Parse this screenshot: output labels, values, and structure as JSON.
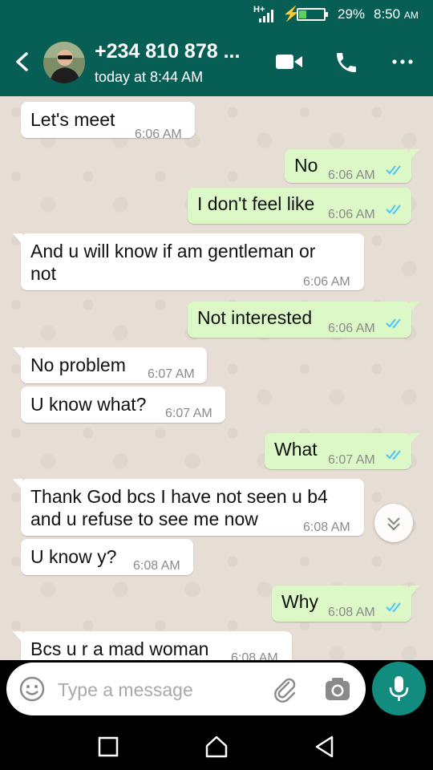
{
  "status_bar": {
    "network": "H+",
    "battery_level": 0.29,
    "battery_percent": "29%",
    "time": "8:50",
    "ampm": "AM"
  },
  "header": {
    "contact": "+234 810 878 ...",
    "last_seen": "today at 8:44 AM"
  },
  "messages": [
    {
      "dir": "in",
      "text": "Let's meet",
      "time": "6:06 AM"
    },
    {
      "dir": "out",
      "text": "No",
      "time": "6:06 AM",
      "read": true
    },
    {
      "dir": "out",
      "text": "I don't feel like",
      "time": "6:06 AM",
      "read": true
    },
    {
      "dir": "in",
      "line1": "And u will know if am gentleman or",
      "line2": "not",
      "time": "6:06 AM"
    },
    {
      "dir": "out",
      "text": "Not interested",
      "time": "6:06 AM",
      "read": true
    },
    {
      "dir": "in",
      "text": "No problem",
      "time": "6:07 AM"
    },
    {
      "dir": "in",
      "text": "U know what?",
      "time": "6:07 AM"
    },
    {
      "dir": "out",
      "text": "What",
      "time": "6:07 AM",
      "read": true
    },
    {
      "dir": "in",
      "line1": "Thank God bcs I have not seen u  b4",
      "line2": "and u refuse to see me now",
      "time": "6:08 AM"
    },
    {
      "dir": "in",
      "text": "U know y?",
      "time": "6:08 AM"
    },
    {
      "dir": "out",
      "text": "Why",
      "time": "6:08 AM",
      "read": true
    },
    {
      "dir": "in",
      "text": "Bcs u r a mad woman",
      "time": "6:08 AM"
    }
  ],
  "composer": {
    "placeholder": "Type a message",
    "value": ""
  },
  "colors": {
    "header": "#075e54",
    "chat_background": "#e6ddd4",
    "outgoing_bubble": "#dcf8c6",
    "incoming_bubble": "#ffffff",
    "read_ticks": "#4fc3f7",
    "mic_button": "#128c7e"
  },
  "icons": [
    "back-arrow-icon",
    "video-call-icon",
    "phone-icon",
    "more-options-icon",
    "double-check-icon",
    "chevron-double-down-icon",
    "emoji-icon",
    "attach-icon",
    "camera-icon",
    "mic-icon",
    "nav-recents-icon",
    "nav-home-icon",
    "nav-back-icon"
  ]
}
